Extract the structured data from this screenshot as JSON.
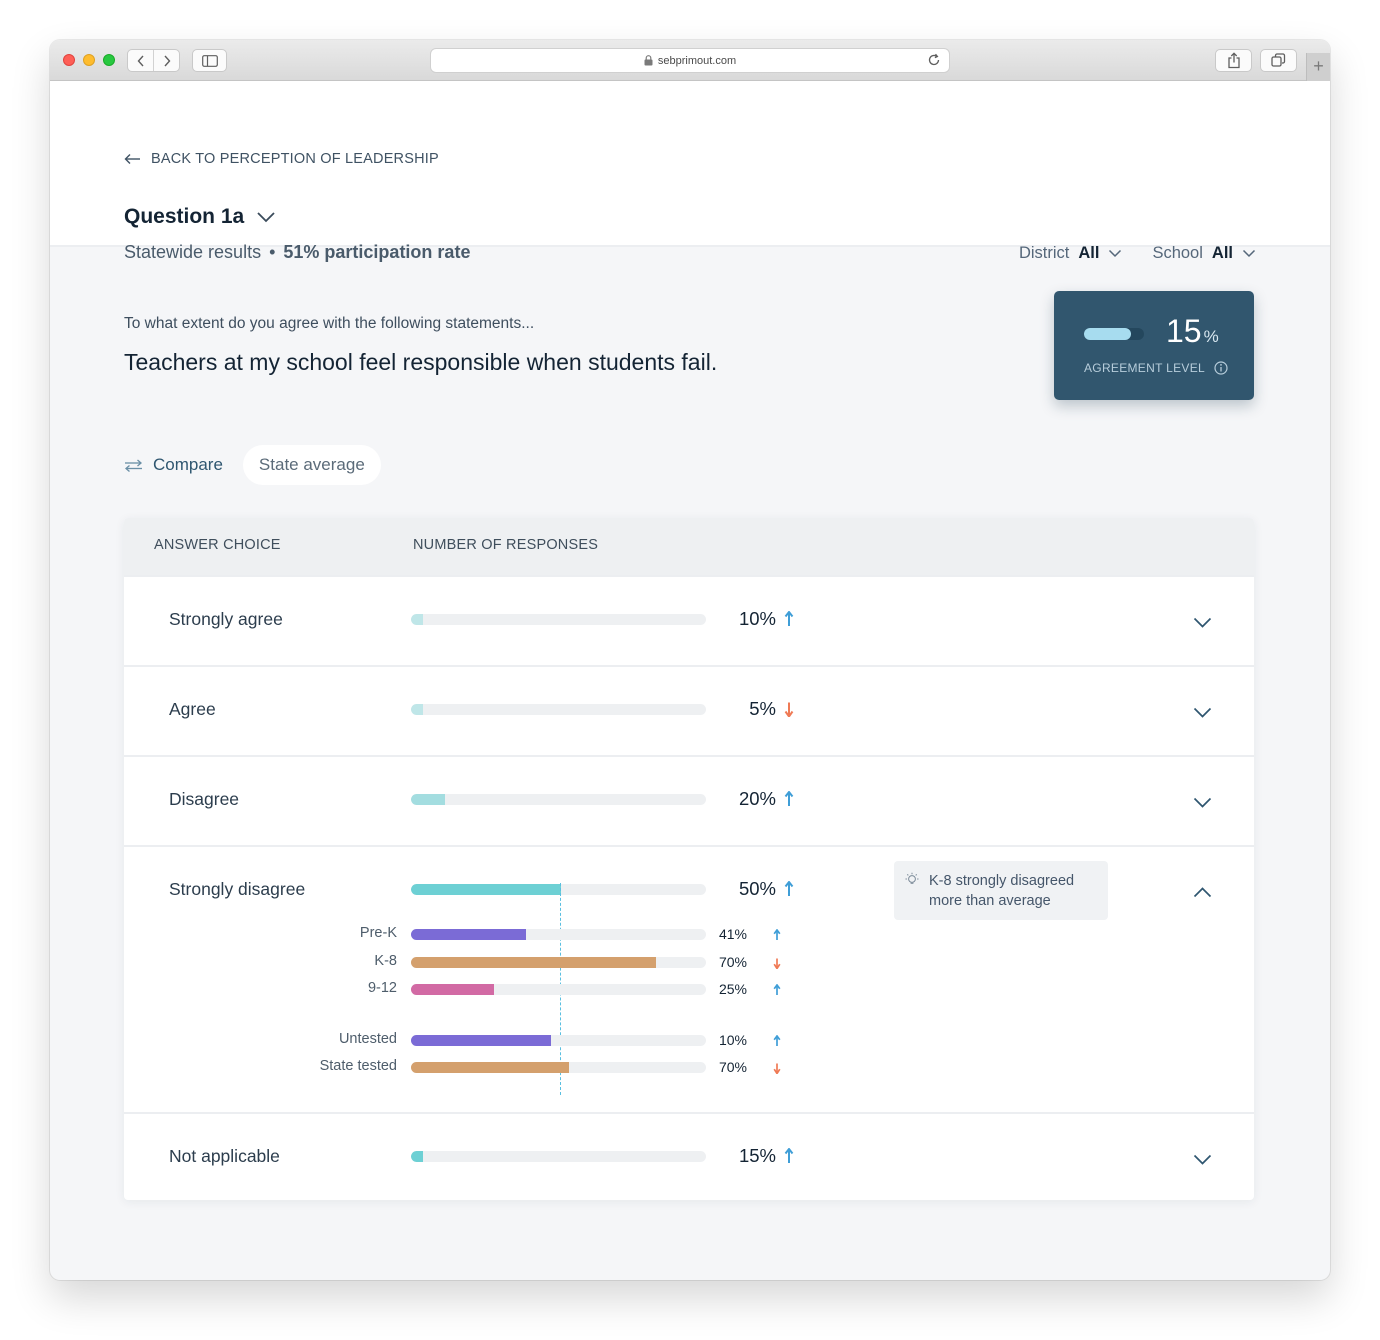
{
  "browser": {
    "url": "sebprimout.com"
  },
  "header": {
    "back_label": "BACK TO PERCEPTION OF LEADERSHIP",
    "question_title": "Question 1a",
    "scope": "Statewide results",
    "separator": "•",
    "participation": "51% participation rate",
    "filters": [
      {
        "label": "District",
        "value": "All"
      },
      {
        "label": "School",
        "value": "All"
      }
    ]
  },
  "question": {
    "prompt": "To what extent do you agree with the following statements...",
    "statement": "Teachers at my school feel responsible when students fail."
  },
  "agreement": {
    "value": "15",
    "unit": "%",
    "label": "AGREEMENT LEVEL",
    "bar_fraction": 0.78,
    "colors": {
      "card": "#31566e",
      "fill": "#a7dcef"
    }
  },
  "compare": {
    "label": "Compare",
    "selected": "State average"
  },
  "table": {
    "columns": [
      "ANSWER CHOICE",
      "NUMBER OF RESPONSES"
    ],
    "rows": [
      {
        "label": "Strongly agree",
        "pct": "10%",
        "trend": "up",
        "fill_fraction": 0.04,
        "fill_color": "#bfe6e8",
        "expanded": false
      },
      {
        "label": "Agree",
        "pct": "5%",
        "trend": "down",
        "fill_fraction": 0.04,
        "fill_color": "#bfe6e8",
        "expanded": false
      },
      {
        "label": "Disagree",
        "pct": "20%",
        "trend": "up",
        "fill_fraction": 0.115,
        "fill_color": "#a3dde0",
        "expanded": false
      },
      {
        "label": "Strongly disagree",
        "pct": "50%",
        "trend": "up",
        "fill_fraction": 0.51,
        "fill_color": "#6dd0d4",
        "expanded": true,
        "insight": "K-8 strongly disagreed more than average",
        "breakdown_groups": [
          [
            {
              "label": "Pre-K",
              "pct": "41%",
              "trend": "up",
              "fill_fraction": 0.39,
              "fill_color": "#7b6bd6"
            },
            {
              "label": "K-8",
              "pct": "70%",
              "trend": "down",
              "fill_fraction": 0.83,
              "fill_color": "#d4a06d"
            },
            {
              "label": "9-12",
              "pct": "25%",
              "trend": "up",
              "fill_fraction": 0.28,
              "fill_color": "#d26aa4"
            }
          ],
          [
            {
              "label": "Untested",
              "pct": "10%",
              "trend": "up",
              "fill_fraction": 0.475,
              "fill_color": "#7b6bd6"
            },
            {
              "label": "State tested",
              "pct": "70%",
              "trend": "down",
              "fill_fraction": 0.535,
              "fill_color": "#d4a06d"
            }
          ]
        ]
      },
      {
        "label": "Not applicable",
        "pct": "15%",
        "trend": "up",
        "fill_fraction": 0.04,
        "fill_color": "#6dd0d4",
        "expanded": false
      }
    ]
  },
  "colors": {
    "trend_up": "#3f9ed7",
    "trend_down": "#ef7a55"
  }
}
